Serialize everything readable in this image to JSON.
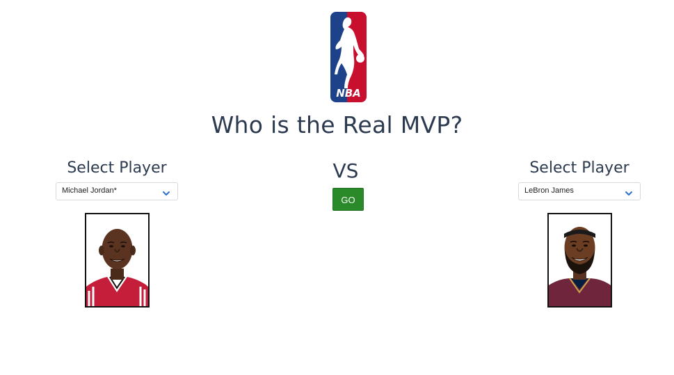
{
  "header": {
    "logo": {
      "icon": "nba-logo-icon",
      "text": "NBA",
      "colors": {
        "blue": "#1d428a",
        "red": "#c8102e",
        "white": "#ffffff"
      }
    },
    "title": "Who is the Real MVP?"
  },
  "player1": {
    "heading": "Select Player",
    "selected": "Michael Jordan*",
    "chevron_icon": "chevron-down-icon",
    "photo": "michael-jordan-portrait"
  },
  "versus": {
    "label": "VS",
    "go_label": "GO",
    "go_color": "#2a8a2a"
  },
  "player2": {
    "heading": "Select Player",
    "selected": "LeBron James",
    "chevron_icon": "chevron-down-icon",
    "photo": "lebron-james-portrait"
  },
  "theme": {
    "text_color": "#2c3a4f",
    "chevron_color": "#2a6fd1"
  }
}
